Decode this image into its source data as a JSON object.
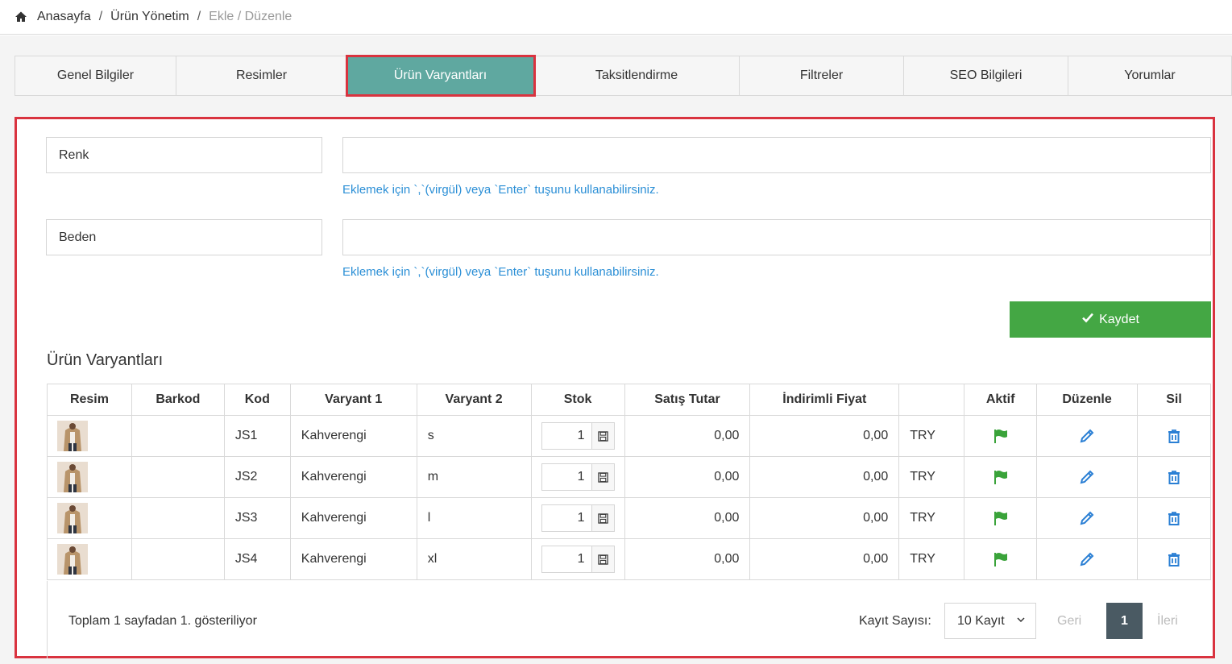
{
  "breadcrumb": {
    "home": "Anasayfa",
    "section": "Ürün Yönetim",
    "current": "Ekle / Düzenle"
  },
  "tabs": [
    {
      "label": "Genel Bilgiler"
    },
    {
      "label": "Resimler"
    },
    {
      "label": "Ürün Varyantları"
    },
    {
      "label": "Taksitlendirme"
    },
    {
      "label": "Filtreler"
    },
    {
      "label": "SEO Bilgileri"
    },
    {
      "label": "Yorumlar"
    }
  ],
  "active_tab": "Ürün Varyantları",
  "form": {
    "color_label": "Renk",
    "color_value": "",
    "color_hint": "Eklemek için `,`(virgül) veya `Enter` tuşunu kullanabilirsiniz.",
    "size_label": "Beden",
    "size_value": "",
    "size_hint": "Eklemek için `,`(virgül) veya `Enter` tuşunu kullanabilirsiniz.",
    "save_label": "Kaydet"
  },
  "section_title": "Ürün Varyantları",
  "table": {
    "headers": [
      "Resim",
      "Barkod",
      "Kod",
      "Varyant 1",
      "Varyant 2",
      "Stok",
      "Satış Tutar",
      "İndirimli Fiyat",
      "",
      "Aktif",
      "Düzenle",
      "Sil"
    ],
    "rows": [
      {
        "barcode": "",
        "code": "JS1",
        "variant1": "Kahverengi",
        "variant2": "s",
        "stock": "1",
        "price": "0,00",
        "discount": "0,00",
        "currency": "TRY"
      },
      {
        "barcode": "",
        "code": "JS2",
        "variant1": "Kahverengi",
        "variant2": "m",
        "stock": "1",
        "price": "0,00",
        "discount": "0,00",
        "currency": "TRY"
      },
      {
        "barcode": "",
        "code": "JS3",
        "variant1": "Kahverengi",
        "variant2": "l",
        "stock": "1",
        "price": "0,00",
        "discount": "0,00",
        "currency": "TRY"
      },
      {
        "barcode": "",
        "code": "JS4",
        "variant1": "Kahverengi",
        "variant2": "xl",
        "stock": "1",
        "price": "0,00",
        "discount": "0,00",
        "currency": "TRY"
      }
    ]
  },
  "footer": {
    "info": "Toplam 1 sayfadan 1. gösteriliyor",
    "page_size_label": "Kayıt Sayısı:",
    "page_size_value": "10 Kayıt",
    "prev": "Geri",
    "page": "1",
    "next": "İleri"
  },
  "colors": {
    "active_tab": "#5fa8a0",
    "highlight_border": "#d9333f",
    "save_button": "#44a744",
    "hint_text": "#2b8fd6",
    "flag": "#3aa33a",
    "edit": "#2a7fd4",
    "delete": "#2a7fd4",
    "page_active": "#4a5a63"
  },
  "icons": {
    "home": "home-icon",
    "save": "check-icon",
    "stock_save": "floppy-disk-icon",
    "active": "flag-icon",
    "edit": "pencil-icon",
    "delete": "trash-icon",
    "dropdown": "chevron-down-icon"
  }
}
